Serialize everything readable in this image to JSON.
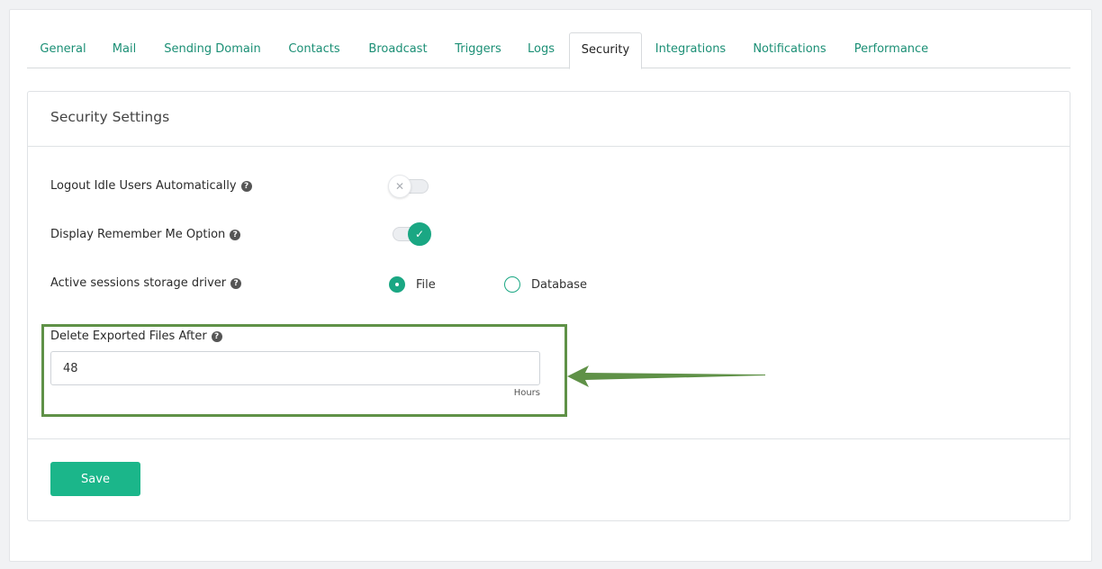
{
  "tabs": [
    {
      "label": "General"
    },
    {
      "label": "Mail"
    },
    {
      "label": "Sending Domain"
    },
    {
      "label": "Contacts"
    },
    {
      "label": "Broadcast"
    },
    {
      "label": "Triggers"
    },
    {
      "label": "Logs"
    },
    {
      "label": "Security"
    },
    {
      "label": "Integrations"
    },
    {
      "label": "Notifications"
    },
    {
      "label": "Performance"
    }
  ],
  "active_tab": "Security",
  "panel": {
    "title": "Security Settings",
    "logout_idle": {
      "label": "Logout Idle Users Automatically",
      "enabled": false,
      "icon": "x-icon"
    },
    "remember_me": {
      "label": "Display Remember Me Option",
      "enabled": true,
      "icon": "check-icon"
    },
    "sessions_driver": {
      "label": "Active sessions storage driver",
      "options": [
        {
          "label": "File",
          "checked": true
        },
        {
          "label": "Database",
          "checked": false
        }
      ]
    },
    "delete_exported": {
      "label": "Delete Exported Files After",
      "value": "48",
      "unit": "Hours"
    },
    "help_icon": "?"
  },
  "save_label": "Save",
  "colors": {
    "accent": "#1aa783",
    "tab_text": "#1b8f75",
    "highlight": "#5f9147"
  }
}
